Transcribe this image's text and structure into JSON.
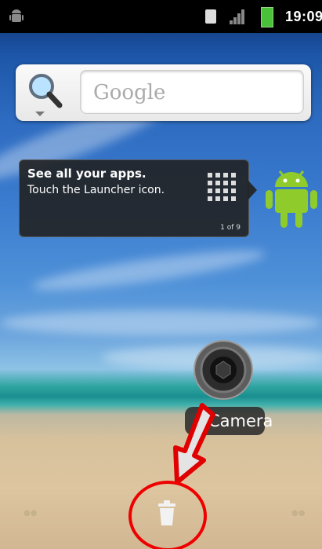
{
  "status_bar": {
    "time": "19:09",
    "icons": [
      "android-icon",
      "sim-icon",
      "signal-icon",
      "battery-icon"
    ]
  },
  "search_widget": {
    "icon": "search-icon",
    "placeholder": "Google"
  },
  "launcher_tip": {
    "title": "See all your apps.",
    "body": "Touch the Launcher icon.",
    "page": "1 of 9",
    "icon": "app-grid-icon"
  },
  "shortcut": {
    "label": "Camera",
    "icon": "camera-icon"
  },
  "dock": {
    "center_icon": "trash-icon"
  },
  "colors": {
    "annotation_red": "#e00000",
    "battery_green": "#49c23a"
  }
}
